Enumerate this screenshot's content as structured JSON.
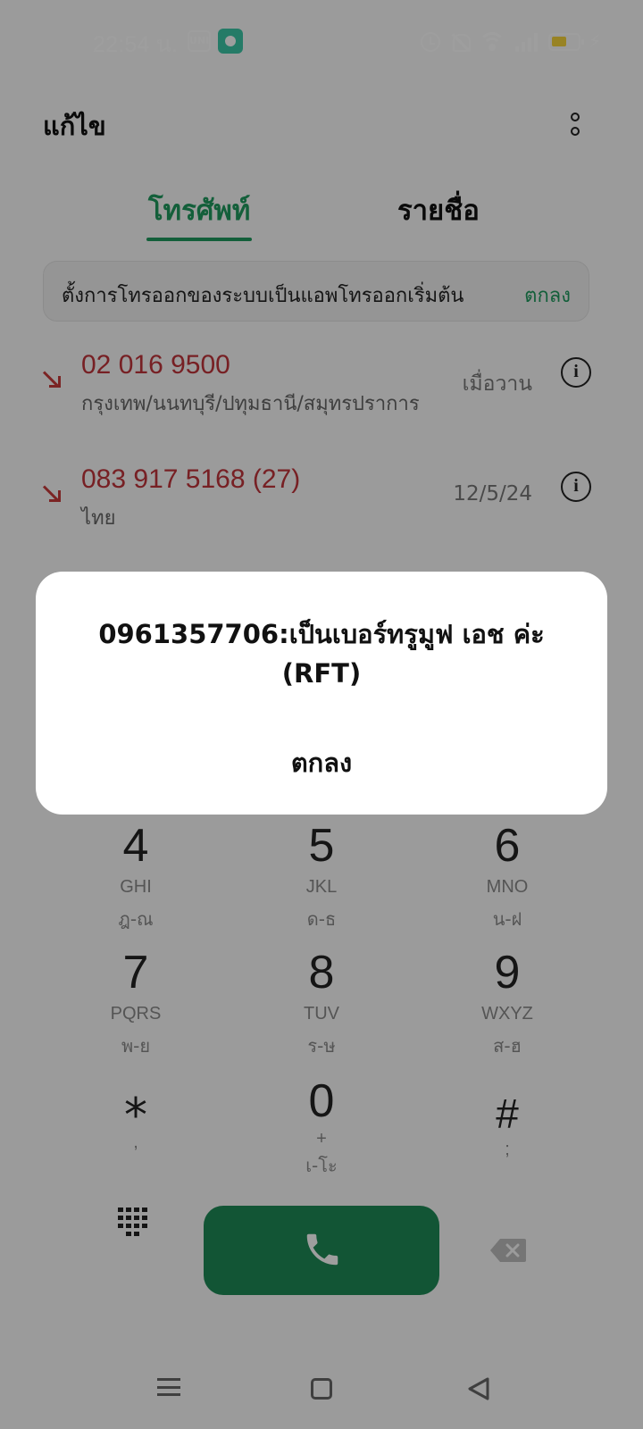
{
  "status_bar": {
    "time": "22:54 น.",
    "app_badge_1": "UNI",
    "icons": [
      "alarm-icon",
      "silent-bell-icon",
      "wifi-icon",
      "signal-icon",
      "battery-icon",
      "charging-icon"
    ]
  },
  "header": {
    "edit_label": "แก้ไข",
    "more_icon": "more-vertical-icon"
  },
  "tabs": [
    {
      "label": "โทรศัพท์",
      "active": true
    },
    {
      "label": "รายชื่อ",
      "active": false
    }
  ],
  "banner": {
    "text": "ตั้งการโทรออกของระบบเป็นแอพโทรออกเริ่มต้น",
    "action": "ตกลง"
  },
  "call_log": [
    {
      "number": "02 016 9500",
      "location": "กรุงเทพ/นนทบุรี/ปทุมธานี/สมุทรปราการ",
      "time": "เมื่อวาน",
      "type": "missed"
    },
    {
      "number": "083 917 5168 (27)",
      "location": "ไทย",
      "time": "12/5/24",
      "type": "missed"
    }
  ],
  "keypad": [
    {
      "digit": "4",
      "letters": "GHI",
      "thai": "ฎ-ณ"
    },
    {
      "digit": "5",
      "letters": "JKL",
      "thai": "ด-ธ"
    },
    {
      "digit": "6",
      "letters": "MNO",
      "thai": "น-ฝ"
    },
    {
      "digit": "7",
      "letters": "PQRS",
      "thai": "พ-ย"
    },
    {
      "digit": "8",
      "letters": "TUV",
      "thai": "ร-ษ"
    },
    {
      "digit": "9",
      "letters": "WXYZ",
      "thai": "ส-ฮ"
    },
    {
      "digit": "⁎",
      "letters": ",",
      "thai": ""
    },
    {
      "digit": "0",
      "letters": "+",
      "thai": "เ-โะ"
    },
    {
      "digit": "#",
      "letters": ";",
      "thai": ""
    }
  ],
  "dialog": {
    "message": "0961357706:เป็นเบอร์ทรูมูฟ เอช ค่ะ (RFT)",
    "ok_label": "ตกลง"
  },
  "colors": {
    "accent": "#1f9a5e",
    "call_button": "#1e8a56",
    "missed": "#c0343b"
  }
}
